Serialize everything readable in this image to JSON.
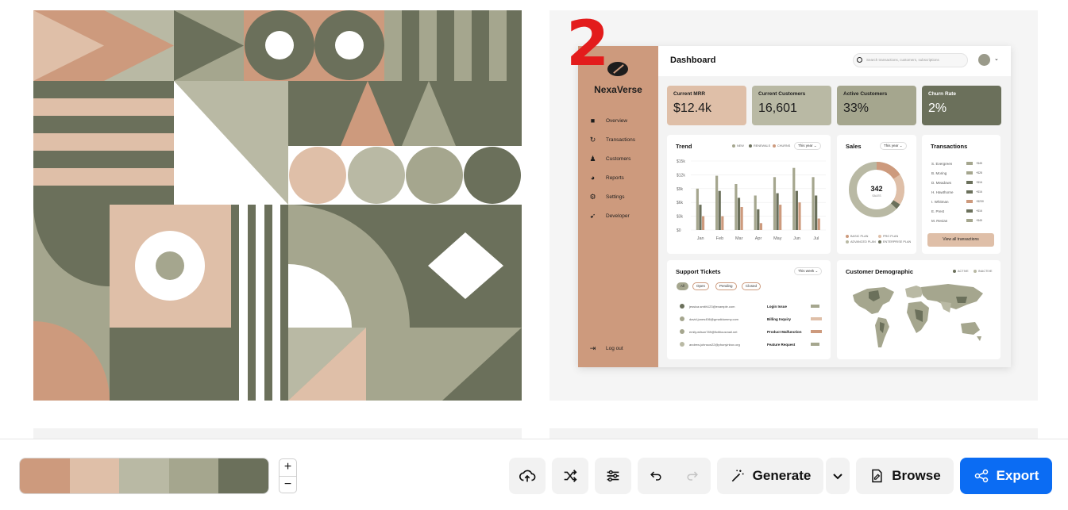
{
  "preview_number": "2",
  "palette": {
    "colors": [
      "#cd9a7d",
      "#dfbfa8",
      "#b9b9a4",
      "#a5a68e",
      "#6b705b"
    ]
  },
  "dashboard": {
    "brand": "NexaVerse",
    "title": "Dashboard",
    "search_placeholder": "Search transactions, customers, subscriptions",
    "nav": [
      {
        "label": "Overview",
        "icon": "grid-icon"
      },
      {
        "label": "Transactions",
        "icon": "refresh-icon"
      },
      {
        "label": "Customers",
        "icon": "people-icon"
      },
      {
        "label": "Reports",
        "icon": "pie-icon"
      },
      {
        "label": "Settings",
        "icon": "gear-icon"
      },
      {
        "label": "Developer",
        "icon": "rocket-icon"
      }
    ],
    "logout": "Log out",
    "kpis": [
      {
        "label": "Current MRR",
        "value": "$12.4k",
        "color": "#dfbfa8"
      },
      {
        "label": "Current Customers",
        "value": "16,601",
        "color": "#b9b9a4"
      },
      {
        "label": "Active Customers",
        "value": "33%",
        "color": "#a5a68e"
      },
      {
        "label": "Churn Rate",
        "value": "2%",
        "color": "#6b705b"
      }
    ],
    "trend": {
      "title": "Trend",
      "filter": "This year",
      "legend": [
        "NEW",
        "RENEWALS",
        "CHURNS"
      ]
    },
    "sales": {
      "title": "Sales",
      "filter": "This year",
      "total": "342",
      "total_label": "SALES",
      "legend": [
        "BASIC PLAN",
        "PRO PLAN",
        "ADVANCED PLAN",
        "ENTERPRISE PLAN"
      ]
    },
    "transactions": {
      "title": "Transactions",
      "rows": [
        {
          "name": "S. Evergreen",
          "amount": "+$45"
        },
        {
          "name": "B. Moring",
          "amount": "+$28"
        },
        {
          "name": "D. Meadows",
          "amount": "+$16"
        },
        {
          "name": "H. Hawthorne",
          "amount": "+$16"
        },
        {
          "name": "I. Whitman",
          "amount": "+$230"
        },
        {
          "name": "E. Prest",
          "amount": "+$16"
        },
        {
          "name": "M. Revian",
          "amount": "+$45"
        }
      ],
      "button": "View all transactions"
    },
    "tickets": {
      "title": "Support Tickets",
      "filter": "This week",
      "tabs": [
        "All",
        "Open",
        "Pending",
        "Closed"
      ],
      "rows": [
        {
          "email": "jessica.smith123@example.com",
          "issue": "Login Issue"
        },
        {
          "email": "david.jones456@gmaildummy.com",
          "issue": "Billing Inquiry"
        },
        {
          "email": "emily.wilson789@fictitiousmail.net",
          "issue": "Product Malfunction"
        },
        {
          "email": "andrew.johnson22@phonyinbox.org",
          "issue": "Feature Request"
        }
      ]
    },
    "demographic": {
      "title": "Customer Demographic",
      "legend": [
        "ACTIVE",
        "INACTIVE"
      ]
    }
  },
  "chart_data": {
    "type": "bar",
    "title": "Trend",
    "categories": [
      "Jan",
      "Feb",
      "Mar",
      "Apr",
      "May",
      "Jun",
      "Jul"
    ],
    "y_ticks": [
      "$15k",
      "$12k",
      "$9k",
      "$6k",
      "$3k",
      "$0"
    ],
    "ylim": [
      0,
      15
    ],
    "series": [
      {
        "name": "NEW",
        "color": "#a5a68e",
        "values": [
          9,
          11.8,
          10,
          7.5,
          11.5,
          13.5,
          11.5
        ]
      },
      {
        "name": "RENEWALS",
        "color": "#6b705b",
        "values": [
          5.5,
          8.5,
          7,
          4.5,
          8,
          8.5,
          7.5
        ]
      },
      {
        "name": "CHURNS",
        "color": "#cd9a7d",
        "values": [
          3,
          3,
          5,
          1.5,
          5.5,
          6,
          2.5
        ]
      }
    ]
  },
  "toolbar": {
    "zoom_in": "+",
    "zoom_out": "−",
    "generate_label": "Generate",
    "browse_label": "Browse",
    "export_label": "Export"
  }
}
